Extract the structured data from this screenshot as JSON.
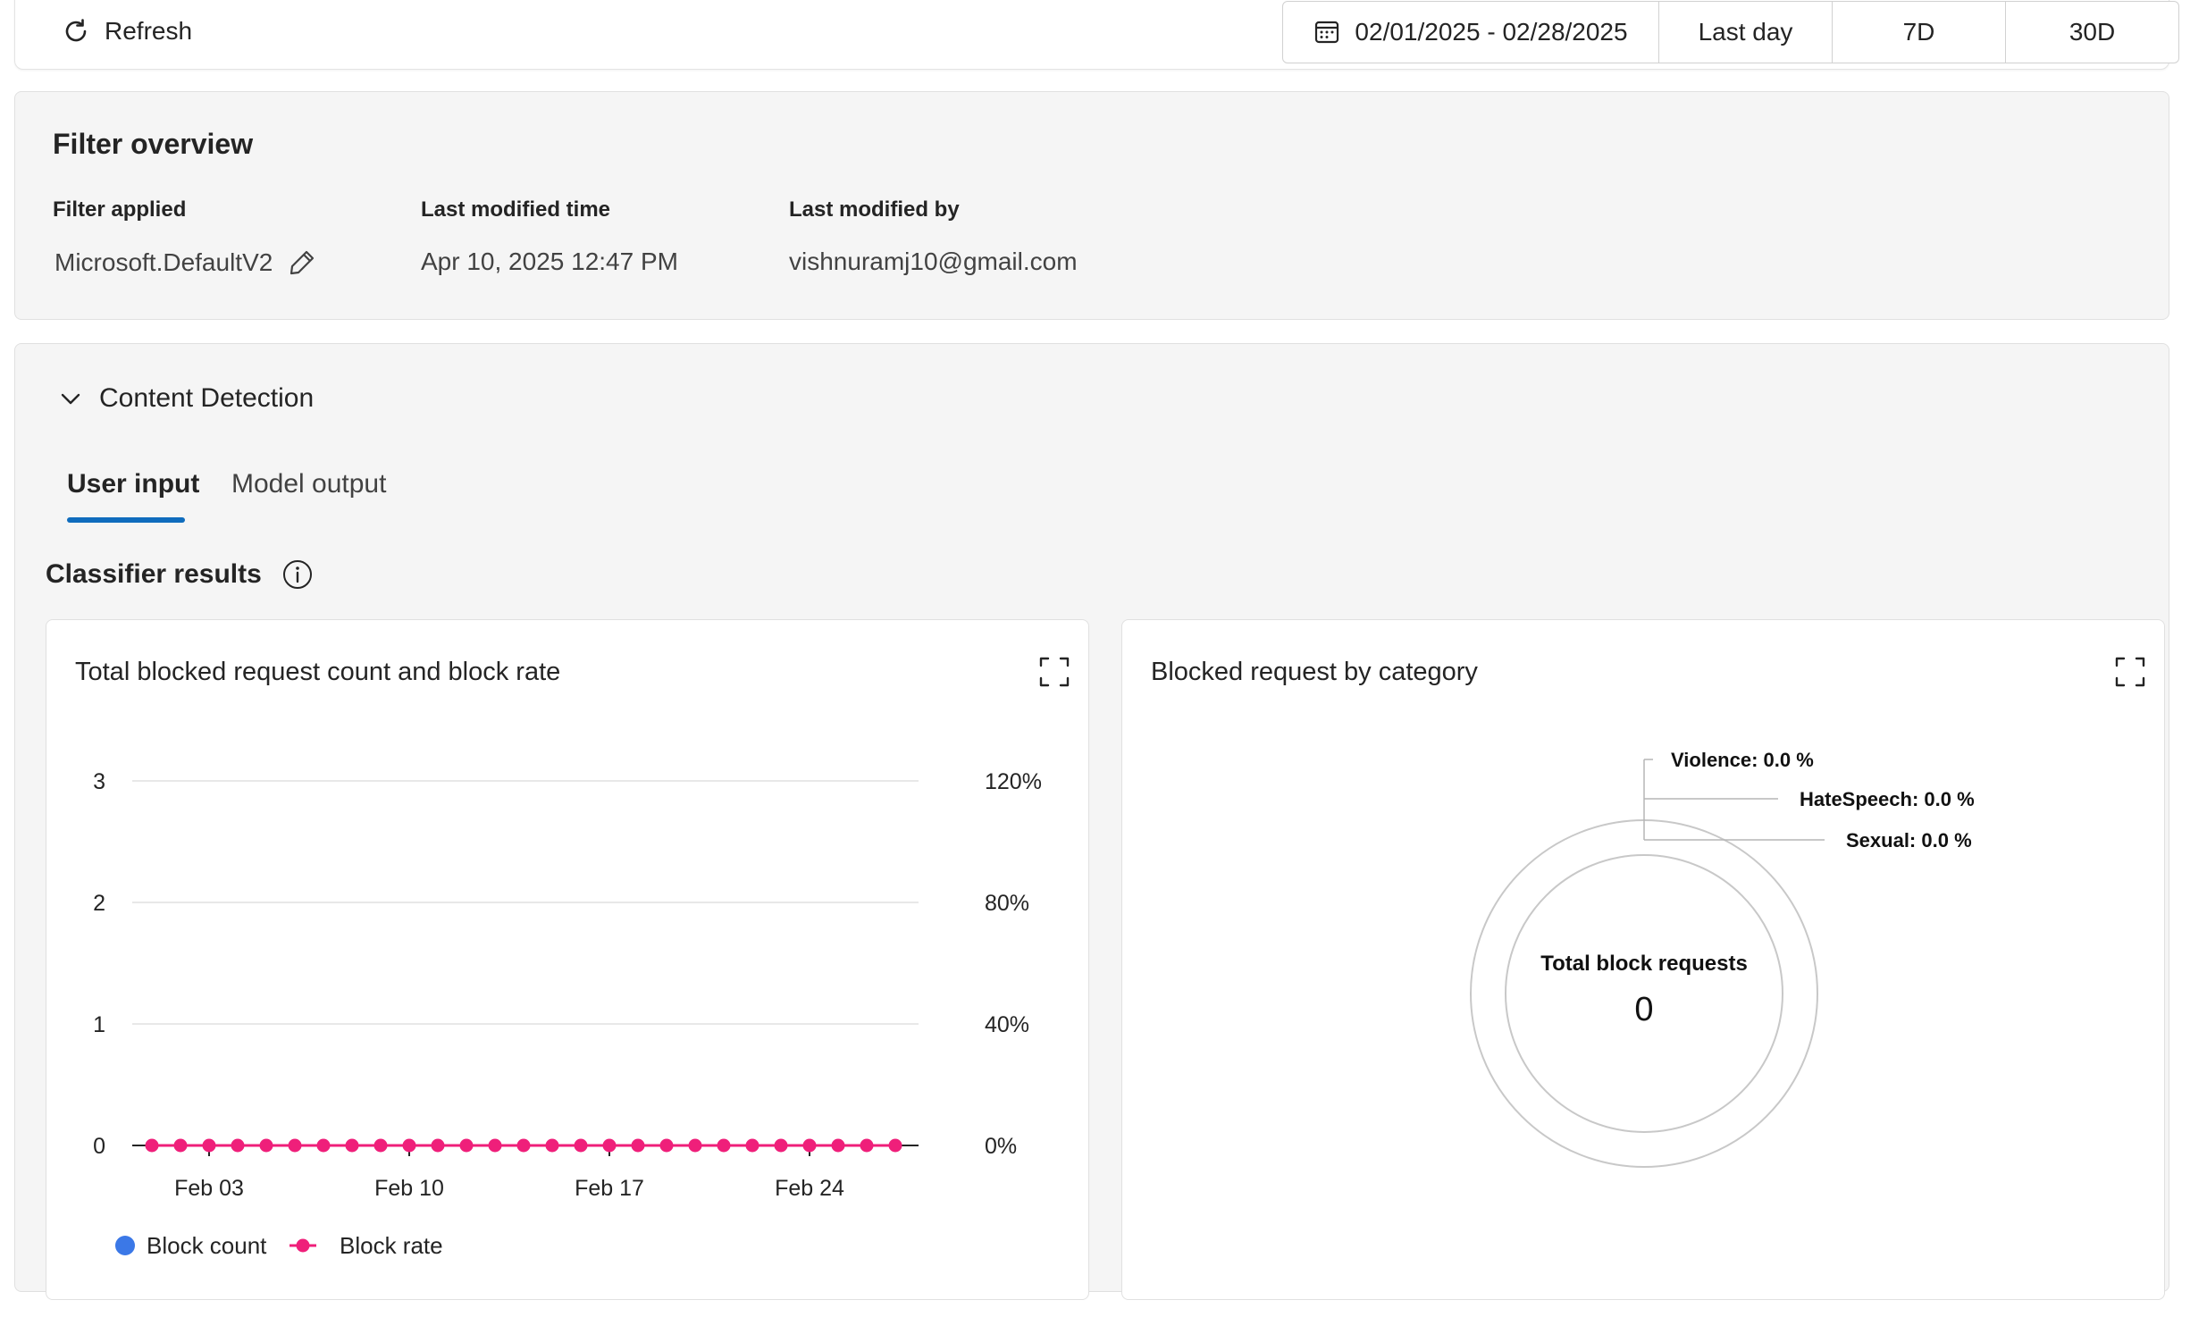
{
  "toolbar": {
    "refresh_label": "Refresh",
    "date_range": "02/01/2025 - 02/28/2025",
    "range_buttons": [
      "Last day",
      "7D",
      "30D"
    ]
  },
  "overview": {
    "title": "Filter overview",
    "filter_label": "Filter applied",
    "filter_value": "Microsoft.DefaultV2",
    "modified_time_label": "Last modified time",
    "modified_time_value": "Apr 10, 2025 12:47 PM",
    "modified_by_label": "Last modified by",
    "modified_by_value": "vishnuramj10@gmail.com"
  },
  "detection": {
    "section_label": "Content Detection",
    "tabs": [
      "User input",
      "Model output"
    ],
    "active_tab": "User input",
    "classifier_title": "Classifier results"
  },
  "colors": {
    "accent": "#0f6cbd",
    "block_count": "#3b78e7",
    "block_rate": "#ef1f7a"
  },
  "chart_data": [
    {
      "type": "line",
      "title": "Total blocked request count and block rate",
      "x": [
        "Feb 01",
        "Feb 02",
        "Feb 03",
        "Feb 04",
        "Feb 05",
        "Feb 06",
        "Feb 07",
        "Feb 08",
        "Feb 09",
        "Feb 10",
        "Feb 11",
        "Feb 12",
        "Feb 13",
        "Feb 14",
        "Feb 15",
        "Feb 16",
        "Feb 17",
        "Feb 18",
        "Feb 19",
        "Feb 20",
        "Feb 21",
        "Feb 22",
        "Feb 23",
        "Feb 24",
        "Feb 25",
        "Feb 26",
        "Feb 27"
      ],
      "x_ticks": [
        "Feb 03",
        "Feb 10",
        "Feb 17",
        "Feb 24"
      ],
      "y_left_ticks": [
        "0",
        "1",
        "2",
        "3"
      ],
      "y_right_ticks": [
        "0%",
        "40%",
        "80%",
        "120%"
      ],
      "ylim": [
        0,
        3
      ],
      "y2lim": [
        0,
        120
      ],
      "series": [
        {
          "name": "Block count",
          "axis": "left",
          "values": [
            0,
            0,
            0,
            0,
            0,
            0,
            0,
            0,
            0,
            0,
            0,
            0,
            0,
            0,
            0,
            0,
            0,
            0,
            0,
            0,
            0,
            0,
            0,
            0,
            0,
            0,
            0
          ]
        },
        {
          "name": "Block rate",
          "axis": "right",
          "values": [
            0,
            0,
            0,
            0,
            0,
            0,
            0,
            0,
            0,
            0,
            0,
            0,
            0,
            0,
            0,
            0,
            0,
            0,
            0,
            0,
            0,
            0,
            0,
            0,
            0,
            0,
            0
          ]
        }
      ],
      "legend": "bottom-left",
      "grid": true
    },
    {
      "type": "pie",
      "title": "Blocked request by category",
      "center_label": "Total block requests",
      "center_value": "0",
      "slices": [
        {
          "label": "Violence: 0.0 %",
          "value": 0
        },
        {
          "label": "HateSpeech: 0.0 %",
          "value": 0
        },
        {
          "label": "Sexual: 0.0 %",
          "value": 0
        }
      ]
    }
  ]
}
